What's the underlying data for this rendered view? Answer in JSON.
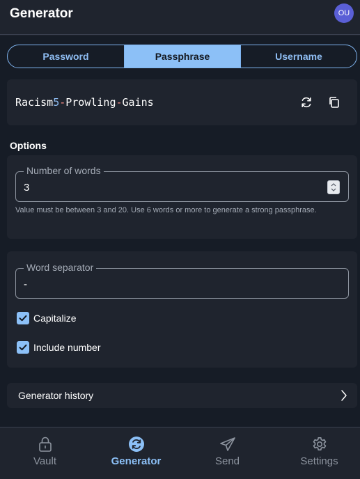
{
  "header": {
    "title": "Generator",
    "avatar_initials": "OU"
  },
  "tabs": [
    {
      "label": "Password",
      "active": false
    },
    {
      "label": "Passphrase",
      "active": true
    },
    {
      "label": "Username",
      "active": false
    }
  ],
  "generated": {
    "parts": [
      {
        "text": "Racism",
        "kind": "word"
      },
      {
        "text": "5",
        "kind": "number"
      },
      {
        "text": "-",
        "kind": "separator"
      },
      {
        "text": "Prowling",
        "kind": "word"
      },
      {
        "text": "-",
        "kind": "separator"
      },
      {
        "text": "Gains",
        "kind": "word"
      }
    ],
    "icons": [
      "refresh-icon",
      "copy-icon"
    ]
  },
  "options": {
    "heading": "Options",
    "number_of_words": {
      "legend": "Number of words",
      "value": "3",
      "hint": "Value must be between 3 and 20. Use 6 words or more to generate a strong passphrase."
    },
    "word_separator": {
      "legend": "Word separator",
      "value": "-"
    },
    "capitalize": {
      "label": "Capitalize",
      "checked": true
    },
    "include_number": {
      "label": "Include number",
      "checked": true
    }
  },
  "history": {
    "label": "Generator history"
  },
  "nav": [
    {
      "label": "Vault",
      "icon": "lock-icon",
      "active": false
    },
    {
      "label": "Generator",
      "icon": "generator-icon",
      "active": true
    },
    {
      "label": "Send",
      "icon": "send-icon",
      "active": false
    },
    {
      "label": "Settings",
      "icon": "gear-icon",
      "active": false
    }
  ],
  "colors": {
    "accent": "#8cc0f7",
    "number": "#8fbdf2",
    "separator": "#ff8f87",
    "background": "#161c26",
    "card": "#1f242e"
  }
}
